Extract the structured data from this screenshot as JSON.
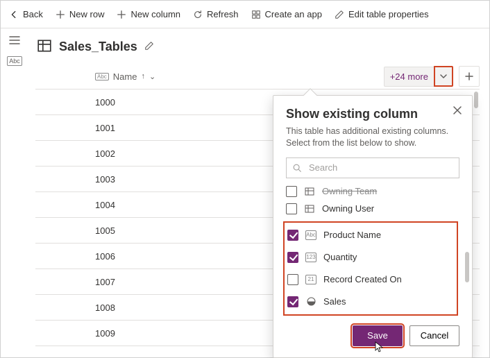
{
  "toolbar": {
    "back": "Back",
    "new_row": "New row",
    "new_column": "New column",
    "refresh": "Refresh",
    "create_app": "Create an app",
    "edit_props": "Edit table properties"
  },
  "table": {
    "name": "Sales_Tables",
    "columns": {
      "name_label": "Name",
      "more_label": "+24 more"
    },
    "rows": [
      "1000",
      "1001",
      "1002",
      "1003",
      "1004",
      "1005",
      "1006",
      "1007",
      "1008",
      "1009"
    ]
  },
  "panel": {
    "title": "Show existing column",
    "description": "This table has additional existing columns. Select from the list below to show.",
    "search_placeholder": "Search",
    "truncated_item": "Owning Team",
    "items": [
      {
        "label": "Owning User",
        "checked": false,
        "type": "lookup"
      },
      {
        "label": "Product Name",
        "checked": true,
        "type": "text"
      },
      {
        "label": "Quantity",
        "checked": true,
        "type": "number"
      },
      {
        "label": "Record Created On",
        "checked": false,
        "type": "date"
      },
      {
        "label": "Sales",
        "checked": true,
        "type": "currency"
      }
    ],
    "save": "Save",
    "cancel": "Cancel"
  }
}
